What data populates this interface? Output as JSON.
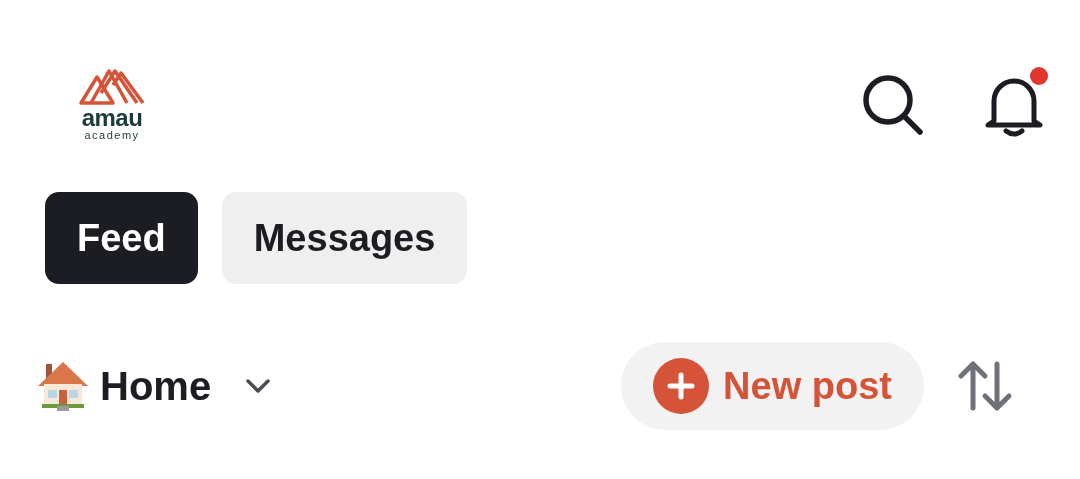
{
  "header": {
    "logo": {
      "name": "amau",
      "subtitle": "academy"
    },
    "notifications": {
      "unread": true
    }
  },
  "tabs": [
    {
      "label": "Feed",
      "selected": true
    },
    {
      "label": "Messages",
      "selected": false
    }
  ],
  "toolbar": {
    "channel": "Home",
    "new_post": "New post"
  }
}
